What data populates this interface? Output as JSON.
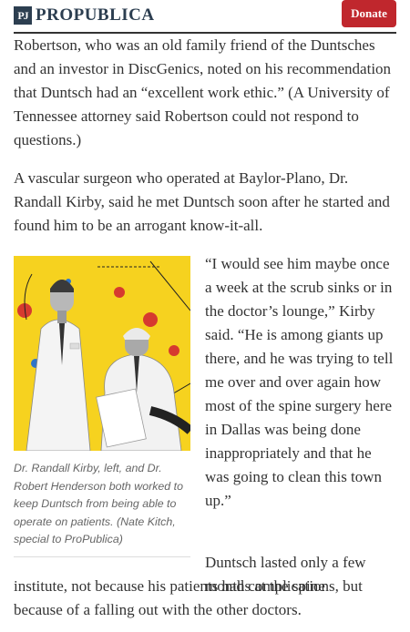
{
  "header": {
    "logo_mark": "PJ",
    "logo_text": "PROPUBLICA",
    "donate_label": "Donate"
  },
  "colors": {
    "brand_navy": "#2c3e50",
    "donate_red": "#c0272d",
    "photo_yellow": "#f6d21f"
  },
  "article": {
    "para1": "Robertson, who was an old family friend of the Duntsches and an investor in DiscGenics, noted on his recommendation that Duntsch had an “excellent work ethic.” (A University of Tennessee attorney said Robertson could not respond to questions.)",
    "para2": "A vascular surgeon who operated at Baylor-Plano, Dr. Randall Kirby, said he met Duntsch soon after he started and found him to be an arrogant know-it-all.",
    "para3": "“I would see him maybe once a week at the scrub sinks or in the doctor’s lounge,” Kirby said. “He is among giants up there, and he was trying to tell me over and over again how most of the spine surgery here in Dallas was being done inappropriately and that he was going to clean this town up.”",
    "para4_start": "Duntsch lasted only a few months at the spine",
    "para4_rest": "institute, not because his patients had complications, but because of a falling out with the other doctors."
  },
  "figure": {
    "caption": "Dr. Randall Kirby, left, and Dr. Robert Henderson both worked to keep Duntsch from being able to operate on patients. (Nate Kitch, special to ProPublica)"
  }
}
